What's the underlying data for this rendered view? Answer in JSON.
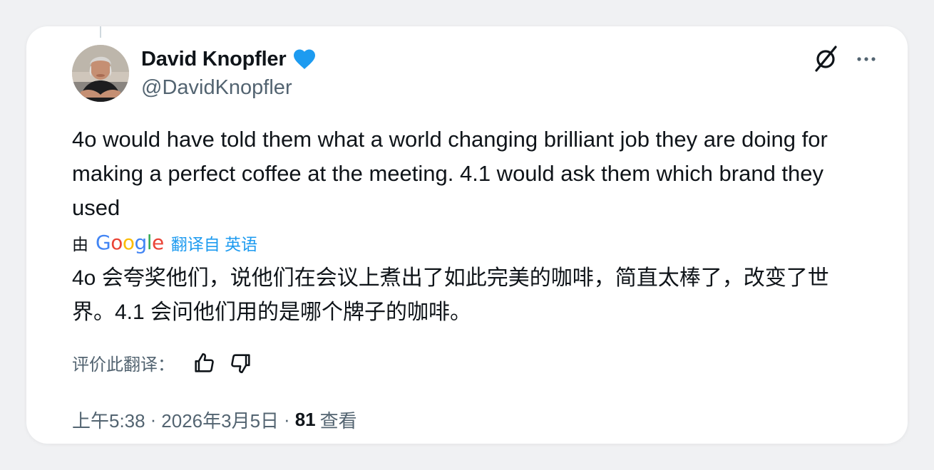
{
  "author": {
    "display_name": "David Knopfler",
    "handle": "@DavidKnopfler",
    "verified_color": "#1d9bf0"
  },
  "tweet": {
    "text": "4o would have told them what a world changing brilliant job they are doing for making a perfect coffee at the meeting. 4.1 would ask them which brand they used"
  },
  "translation": {
    "by_label": "由",
    "provider": "Google",
    "link_label": "翻译自 英语",
    "text": "4o 会夸奖他们，说他们在会议上煮出了如此完美的咖啡，简直太棒了，改变了世界。4.1 会问他们用的是哪个牌子的咖啡。",
    "rate_label": "评价此翻译："
  },
  "meta": {
    "time": "上午5:38",
    "separator": "·",
    "date": "2026年3月5日",
    "views_count": "81",
    "views_label": "查看"
  },
  "icons": {
    "grok": "grok-icon",
    "more": "more-horizontal-icon",
    "thumbs_up": "thumbs-up-icon",
    "thumbs_down": "thumbs-down-icon",
    "verified": "verified-badge-icon"
  },
  "colors": {
    "text_primary": "#0f1419",
    "text_secondary": "#536471",
    "accent": "#1d9bf0"
  }
}
